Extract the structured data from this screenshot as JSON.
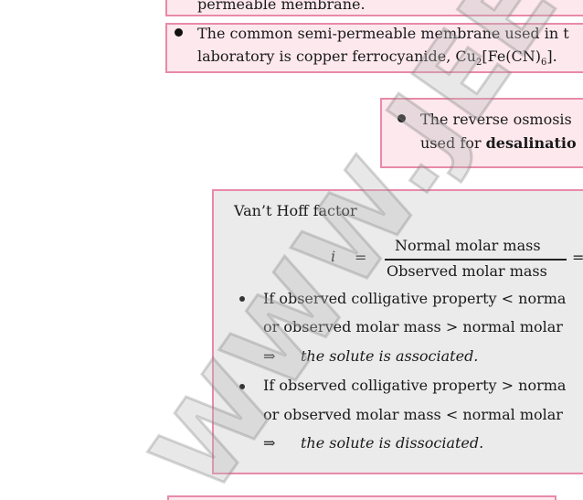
{
  "box1": {
    "text": "permeable membrane."
  },
  "box2": {
    "line1": "The common semi-permeable membrane used in t",
    "line2_prefix": "laboratory is copper ferrocyanide, Cu",
    "line2_sub1": "2",
    "line2_mid": "[Fe(CN)",
    "line2_sub2": "6",
    "line2_suffix": "]."
  },
  "box3": {
    "line1": "The reverse osmosis",
    "line2_prefix": "used for ",
    "line2_bold": "desalinatio"
  },
  "box4": {
    "title": "Van’t Hoff factor",
    "formula": {
      "lhs": "i",
      "eq1": "=",
      "numerator": "Normal molar mass",
      "denominator": "Observed molar mass",
      "eq2": "="
    },
    "bullet1": {
      "line1": "If observed colligative property < norma",
      "line2": "or observed molar mass > normal molar",
      "arrow": "⇒",
      "conclusion": "the solute is associated."
    },
    "bullet2": {
      "line1": "If observed colligative property > norma",
      "line2": "or observed molar mass < normal molar",
      "arrow": "⇒",
      "conclusion": "the solute is dissociated."
    }
  },
  "watermark": "WWW.JEE"
}
